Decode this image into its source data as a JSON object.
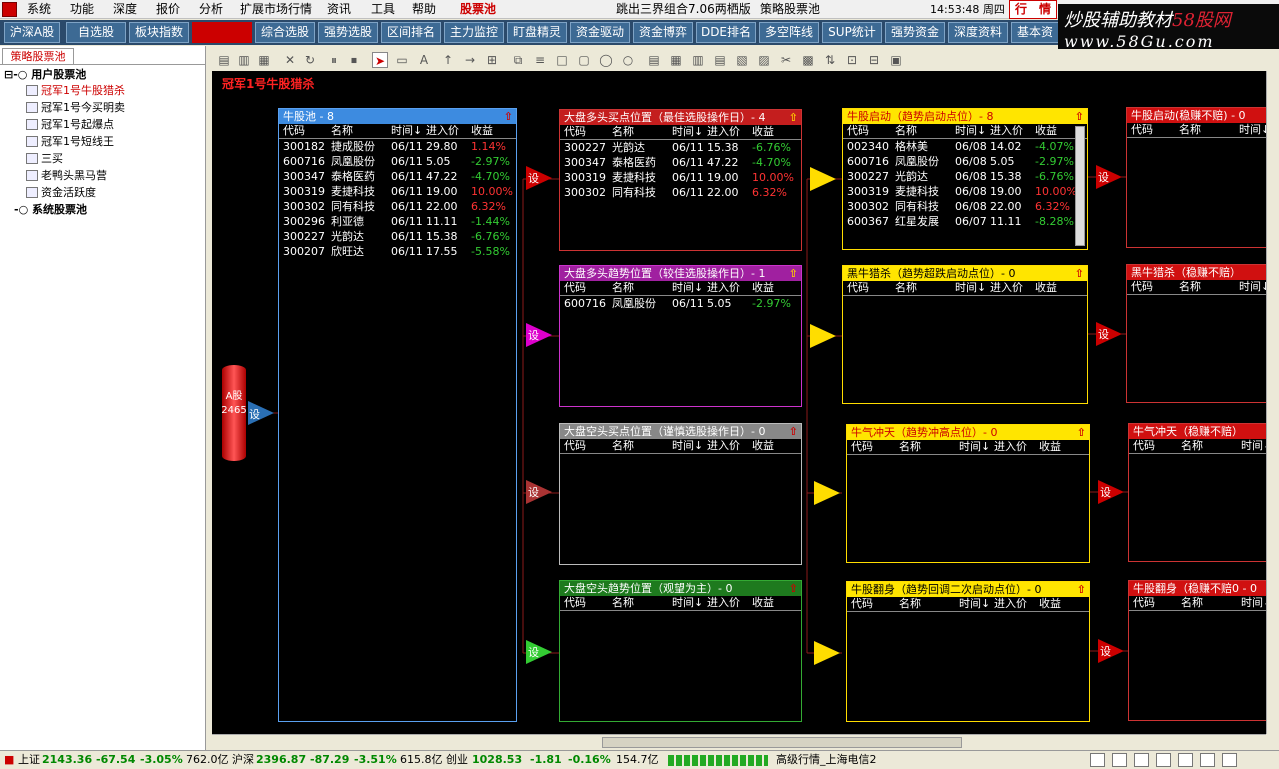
{
  "menu": {
    "items": [
      "系统",
      "功能",
      "深度",
      "报价",
      "分析",
      "扩展市场行情",
      "资讯",
      "工具",
      "帮助"
    ],
    "active": "股票池",
    "tab_text": "跳出三界组合7.06两栖版",
    "tab_text2": "策略股票池",
    "clock": "14:53:48 周四",
    "trade": "行　情"
  },
  "tabs": [
    "沪深A股",
    "自选股",
    "板块指数",
    "",
    "综合选股",
    "强势选股",
    "区间排名",
    "主力监控",
    "盯盘精灵",
    "资金驱动",
    "资金博弈",
    "DDE排名",
    "多空阵线",
    "SUP统计",
    "强势资金",
    "深度资料",
    "基本资"
  ],
  "watermark": {
    "line1_a": "炒股辅助教材",
    "line1_b": "58股网",
    "line2": "www.58Gu.com"
  },
  "left": {
    "tab": "策略股票池",
    "tree": [
      {
        "label": "用户股票池",
        "bold": true
      },
      {
        "label": "冠军1号牛股猎杀",
        "selected": true
      },
      {
        "label": "冠军1号今买明卖"
      },
      {
        "label": "冠军1号起爆点"
      },
      {
        "label": "冠军1号短线王"
      },
      {
        "label": "三买"
      },
      {
        "label": "老鸭头黑马营"
      },
      {
        "label": "资金活跃度"
      },
      {
        "label": "系统股票池",
        "bold": true
      }
    ]
  },
  "canvas": {
    "title": "冠军1号牛股猎杀",
    "source_label": "A股",
    "source_count": "2465",
    "set_label": "设",
    "columns": [
      "代码",
      "名称",
      "时间↓",
      "进入价",
      "收益"
    ],
    "pool": {
      "title": "牛股池 - 8",
      "rows": [
        [
          "300182",
          "捷成股份",
          "06/11",
          "29.80",
          "1.14%",
          "r"
        ],
        [
          "600716",
          "凤凰股份",
          "06/11",
          "5.05",
          "-2.97%",
          "g"
        ],
        [
          "300347",
          "泰格医药",
          "06/11",
          "47.22",
          "-4.70%",
          "g"
        ],
        [
          "300319",
          "麦捷科技",
          "06/11",
          "19.00",
          "10.00%",
          "r"
        ],
        [
          "300302",
          "同有科技",
          "06/11",
          "22.00",
          "6.32%",
          "r"
        ],
        [
          "300296",
          "利亚德",
          "06/11",
          "11.11",
          "-1.44%",
          "g"
        ],
        [
          "300227",
          "光韵达",
          "06/11",
          "15.38",
          "-6.76%",
          "g"
        ],
        [
          "300207",
          "欣旺达",
          "06/11",
          "17.55",
          "-5.58%",
          "g"
        ]
      ]
    },
    "mid": [
      {
        "title": "大盘多头买点位置（最佳选股操作日）- 4",
        "rows": [
          [
            "300227",
            "光韵达",
            "06/11",
            "15.38",
            "-6.76%",
            "g"
          ],
          [
            "300347",
            "泰格医药",
            "06/11",
            "47.22",
            "-4.70%",
            "g"
          ],
          [
            "300319",
            "麦捷科技",
            "06/11",
            "19.00",
            "10.00%",
            "r"
          ],
          [
            "300302",
            "同有科技",
            "06/11",
            "22.00",
            "6.32%",
            "r"
          ]
        ]
      },
      {
        "title": "大盘多头趋势位置（较佳选股操作日）- 1",
        "rows": [
          [
            "600716",
            "凤凰股份",
            "06/11",
            "5.05",
            "-2.97%",
            "g"
          ]
        ]
      },
      {
        "title": "大盘空头买点位置（谨慎选股操作日）- 0",
        "rows": []
      },
      {
        "title": "大盘空头趋势位置（观望为主）- 0",
        "rows": []
      }
    ],
    "right": [
      {
        "title": "牛股启动（趋势启动点位）- 8",
        "rows": [
          [
            "002340",
            "格林美",
            "06/08",
            "14.02",
            "-4.07%",
            "g"
          ],
          [
            "600716",
            "凤凰股份",
            "06/08",
            "5.05",
            "-2.97%",
            "g"
          ],
          [
            "300227",
            "光韵达",
            "06/08",
            "15.38",
            "-6.76%",
            "g"
          ],
          [
            "300319",
            "麦捷科技",
            "06/08",
            "19.00",
            "10.00%",
            "r"
          ],
          [
            "300302",
            "同有科技",
            "06/08",
            "22.00",
            "6.32%",
            "r"
          ],
          [
            "600367",
            "红星发展",
            "06/07",
            "11.11",
            "-8.28%",
            "g"
          ]
        ]
      },
      {
        "title": "黑牛猎杀（趋势超跌启动点位）- 0",
        "rows": []
      },
      {
        "title": "牛气冲天（趋势冲高点位）- 0",
        "rows": []
      },
      {
        "title": "牛股翻身（趋势回调二次启动点位）- 0",
        "rows": []
      }
    ],
    "far": [
      {
        "title": "牛股启动(稳赚不赔) - 0"
      },
      {
        "title": "黑牛猎杀（稳赚不赔）"
      },
      {
        "title": "牛气冲天（稳赚不赔）"
      },
      {
        "title": "牛股翻身（稳赚不赔0 - 0"
      }
    ]
  },
  "status": {
    "sh_label": "上证",
    "sh_val": "2143.36",
    "sh_chg": "-67.54",
    "sh_pct": "-3.05%",
    "sh_amt": "762.0亿",
    "sz_label": "沪深",
    "sz_val": "2396.87",
    "sz_chg": "-87.29",
    "sz_pct": "-3.51%",
    "sz_amt": "615.8亿",
    "cy_label": "创业",
    "cy_val": "1028.53",
    "cy_chg": "-1.81",
    "cy_pct": "-0.16%",
    "cy_amt": "154.7亿",
    "server": "高级行情_上海电信2"
  }
}
